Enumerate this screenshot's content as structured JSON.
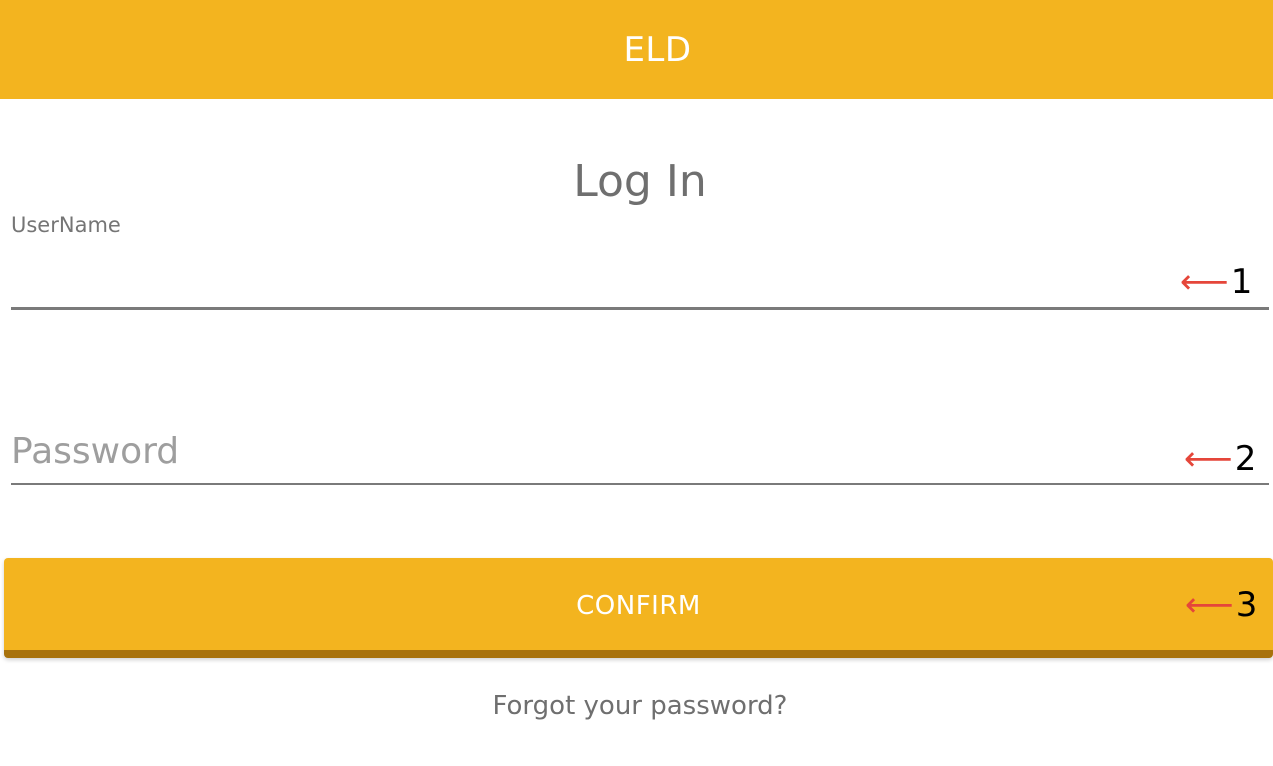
{
  "app_bar": {
    "title": "ELD",
    "background_color": "#F3B41F"
  },
  "login": {
    "heading": "Log In",
    "username": {
      "label": "UserName",
      "value": ""
    },
    "password": {
      "placeholder": "Password",
      "value": ""
    },
    "confirm_label": "CONFIRM",
    "forgot_label": "Forgot your password?"
  },
  "annotations": [
    {
      "arrow": "⟵",
      "number": "1"
    },
    {
      "arrow": "⟵",
      "number": "2"
    },
    {
      "arrow": "⟵",
      "number": "3"
    }
  ],
  "colors": {
    "accent": "#F3B41F",
    "button_shadow": "#A8720C",
    "annotation_arrow": "#E5463A"
  }
}
